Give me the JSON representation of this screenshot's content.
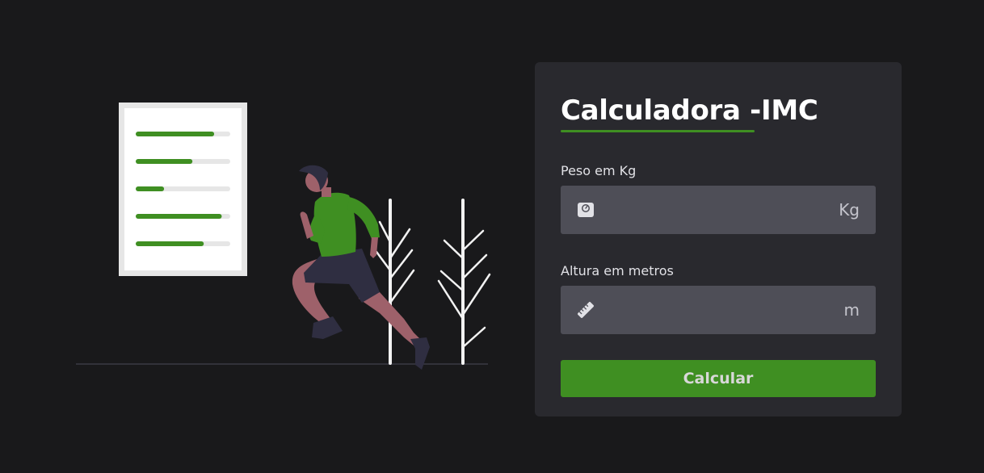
{
  "title": "Calculadora -IMC",
  "weight": {
    "label": "Peso em Kg",
    "value": "",
    "unit": "Kg",
    "icon": "scale-icon"
  },
  "height": {
    "label": "Altura em metros",
    "value": "",
    "unit": "m",
    "icon": "ruler-icon"
  },
  "submit_label": "Calcular",
  "colors": {
    "background": "#19191b",
    "card": "#29292e",
    "input": "#4e4e57",
    "accent": "#3f8f22"
  },
  "illustration": {
    "description_icon": "runner-illustration",
    "document_progress": [
      0.83,
      0.6,
      0.3,
      0.91,
      0.72
    ]
  }
}
